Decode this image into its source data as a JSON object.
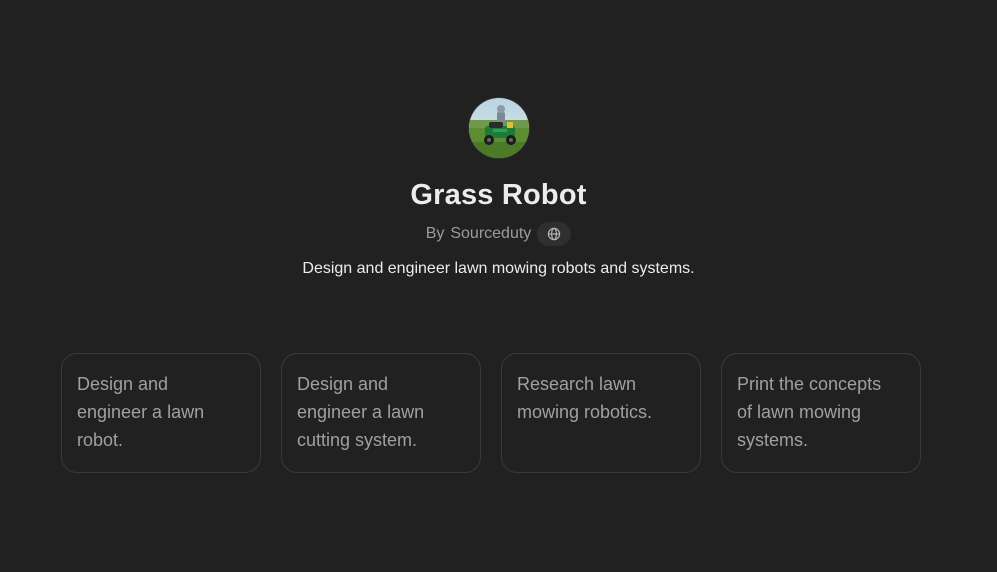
{
  "gpt": {
    "name": "Grass Robot",
    "by_prefix": "By",
    "author": "Sourceduty",
    "description": "Design and engineer lawn mowing robots and systems.",
    "avatar_icon": "lawn-mower-robot-avatar",
    "author_link_icon": "globe-icon"
  },
  "starters": [
    {
      "label": "Design and engineer a lawn robot."
    },
    {
      "label": "Design and engineer a lawn cutting system."
    },
    {
      "label": "Research lawn mowing robotics."
    },
    {
      "label": "Print the concepts of lawn mowing systems."
    }
  ],
  "colors": {
    "background": "#212121",
    "text_primary": "#ececec",
    "text_secondary": "#9b9b9b",
    "card_border": "#3a3a3a"
  }
}
